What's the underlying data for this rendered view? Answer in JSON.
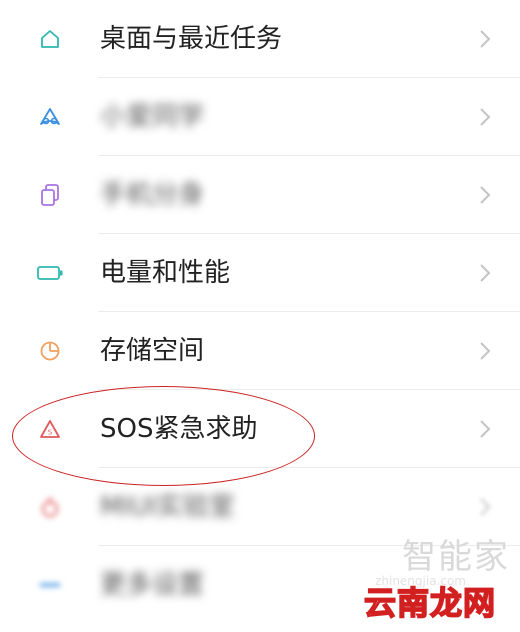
{
  "colors": {
    "accent_teal": "#30b8b0",
    "accent_blue": "#3a8fe0",
    "accent_purple": "#a874e0",
    "accent_orange": "#f0a060",
    "accent_red": "#e05a5a",
    "annotation_red": "#cc2222",
    "chevron": "#c4c4c4"
  },
  "settings": {
    "items": [
      {
        "label": "桌面与最近任务",
        "icon": "home-icon"
      },
      {
        "label": "小爱同学",
        "icon": "xiaoai-icon",
        "blurred": true
      },
      {
        "label": "手机分身",
        "icon": "dual-phone-icon",
        "blurred": true
      },
      {
        "label": "电量和性能",
        "icon": "battery-icon"
      },
      {
        "label": "存储空间",
        "icon": "storage-pie-icon"
      },
      {
        "label": "SOS紧急求助",
        "icon": "sos-icon"
      },
      {
        "label": "MIUI实验室",
        "icon": "lab-icon",
        "blurred": true
      },
      {
        "label": "更多设置",
        "icon": "more-icon",
        "blurred": true
      }
    ]
  },
  "watermark": {
    "logo": "智能家",
    "url": "zhinengjia.com",
    "site": "云南龙网"
  }
}
